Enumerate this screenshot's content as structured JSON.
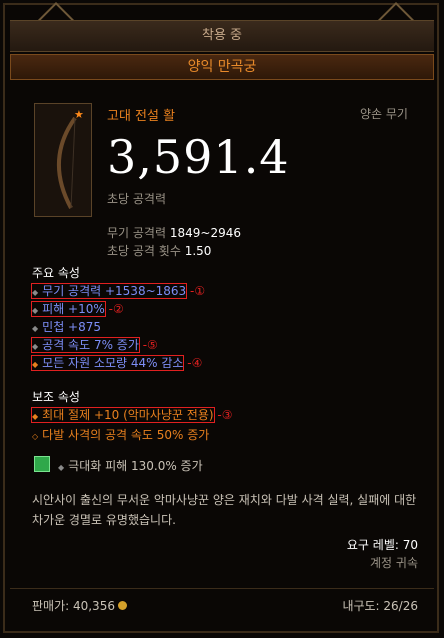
{
  "header": {
    "title": "착용 중"
  },
  "item": {
    "name": "양익 만곡궁",
    "quality": "고대 전설 활",
    "slot": "양손 무기",
    "dps": "3,591.4",
    "dps_label": "초당 공격력",
    "damage_label": "무기 공격력",
    "damage_value": "1849~2946",
    "aps_label": "초당 공격 횟수",
    "aps_value": "1.50",
    "icon": "bow-icon"
  },
  "primary": {
    "title": "주요 속성",
    "affixes": [
      {
        "text": "무기 공격력 +1538~1863",
        "marker": "-①"
      },
      {
        "text": "피해 +10%",
        "marker": "-②"
      },
      {
        "text": "민첩 +875",
        "marker": ""
      },
      {
        "text": "공격 속도 7% 증가",
        "marker": "-⑤"
      },
      {
        "text": "모든 자원 소모량 44% 감소",
        "marker": "-④"
      }
    ]
  },
  "secondary": {
    "title": "보조 속성",
    "affixes": [
      {
        "text": "최대 절제 +10 (악마사냥꾼 전용)",
        "marker": "-③"
      },
      {
        "text": "다발 사격의 공격 속도 50% 증가",
        "marker": ""
      }
    ]
  },
  "socket": {
    "text": "극대화 피해 130.0% 증가",
    "icon": "emerald-gem-icon"
  },
  "flavor": "시안사이 출신의 무서운 악마사냥꾼 양은 재치와 다발 사격 실력, 실패에 대한 차가운 경멸로 유명했습니다.",
  "requirement": "요구 레벨: 70",
  "account_bound": "계정 귀속",
  "footer": {
    "price": "판매가: 40,356",
    "durability": "내구도: 26/26"
  },
  "colors": {
    "legendary": "#e8801e",
    "magic": "#7d8ef5",
    "highlight": "#e12020"
  }
}
